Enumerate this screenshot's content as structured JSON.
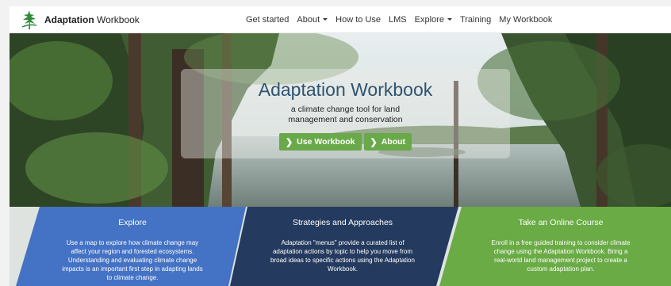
{
  "navbar": {
    "brand_bold": "Adaptation",
    "brand_rest": " Workbook",
    "items": [
      {
        "label": "Get started"
      },
      {
        "label": "About"
      },
      {
        "label": "How to Use"
      },
      {
        "label": "LMS"
      },
      {
        "label": "Explore"
      },
      {
        "label": "Training"
      },
      {
        "label": "My Workbook"
      }
    ]
  },
  "hero": {
    "title": "Adaptation Workbook",
    "subtitle_line1": "a climate change tool for land",
    "subtitle_line2": "management and conservation",
    "buttons": [
      {
        "label": "Use Workbook"
      },
      {
        "label": "About"
      }
    ]
  },
  "panels": [
    {
      "title": "Explore",
      "body": [
        "Use a map to explore how climate change may",
        "affect your region and forested ecosystems.",
        "Understanding and evaluating climate change",
        "impacts is an important first step in adapting lands",
        "to climate change."
      ],
      "color": "#4472c4"
    },
    {
      "title": "Strategies and Approaches",
      "body": [
        "Adaptation \"menus\" provide a curated list of",
        "adaptation actions by topic to help you move from",
        "broad ideas to specific actions using the Adaptation",
        "Workbook."
      ],
      "color": "#243a5e"
    },
    {
      "title": "Take an Online Course",
      "body": [
        "Enroll in a free guided training to consider climate",
        "change using the Adaptation Workbook. Bring a",
        "real-world land management project to create a",
        "custom adaptation plan."
      ],
      "color": "#6aab45"
    }
  ],
  "colors": {
    "brand_green": "#2e8b3a",
    "button_green": "#6aa94a",
    "title_blue": "#2f5470"
  }
}
